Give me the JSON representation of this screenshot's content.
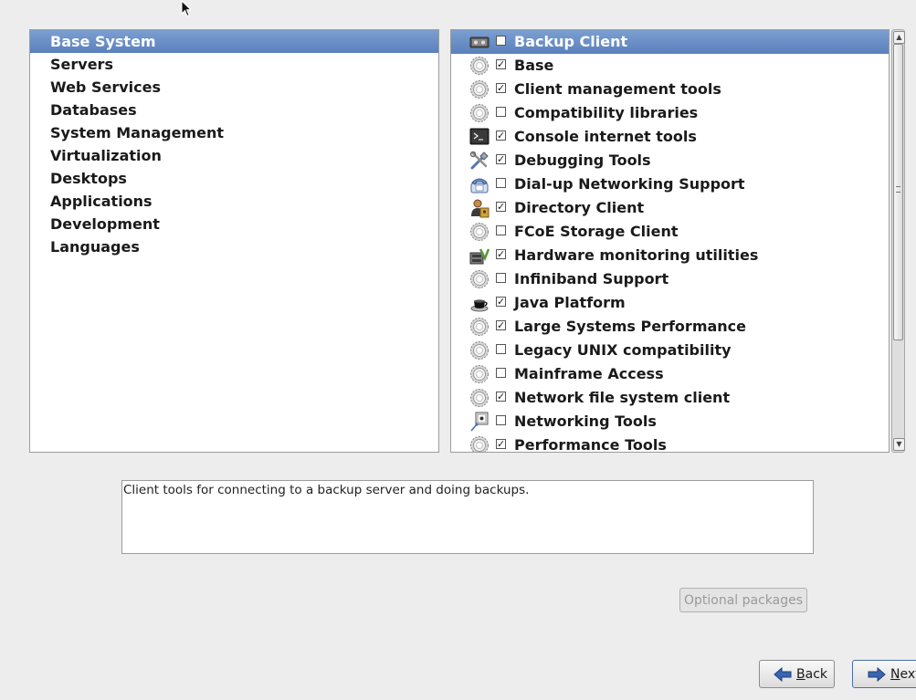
{
  "categories": [
    {
      "label": "Base System",
      "selected": true
    },
    {
      "label": "Servers"
    },
    {
      "label": "Web Services"
    },
    {
      "label": "Databases"
    },
    {
      "label": "System Management"
    },
    {
      "label": "Virtualization"
    },
    {
      "label": "Desktops"
    },
    {
      "label": "Applications"
    },
    {
      "label": "Development"
    },
    {
      "label": "Languages"
    }
  ],
  "groups": [
    {
      "label": "Backup Client",
      "checked": false,
      "icon": "backup-drive-icon",
      "selected": true
    },
    {
      "label": "Base",
      "checked": true,
      "icon": "gear-icon"
    },
    {
      "label": "Client management tools",
      "checked": true,
      "icon": "gear-icon"
    },
    {
      "label": "Compatibility libraries",
      "checked": false,
      "icon": "gear-icon"
    },
    {
      "label": "Console internet tools",
      "checked": true,
      "icon": "terminal-icon"
    },
    {
      "label": "Debugging Tools",
      "checked": true,
      "icon": "tools-icon"
    },
    {
      "label": "Dial-up Networking Support",
      "checked": false,
      "icon": "phone-icon"
    },
    {
      "label": "Directory Client",
      "checked": true,
      "icon": "users-icon"
    },
    {
      "label": "FCoE Storage Client",
      "checked": false,
      "icon": "gear-icon"
    },
    {
      "label": "Hardware monitoring utilities",
      "checked": true,
      "icon": "hardware-monitor-icon"
    },
    {
      "label": "Infiniband Support",
      "checked": false,
      "icon": "gear-icon"
    },
    {
      "label": "Java Platform",
      "checked": true,
      "icon": "java-cup-icon"
    },
    {
      "label": "Large Systems Performance",
      "checked": true,
      "icon": "gear-icon"
    },
    {
      "label": "Legacy UNIX compatibility",
      "checked": false,
      "icon": "gear-icon"
    },
    {
      "label": "Mainframe Access",
      "checked": false,
      "icon": "gear-icon"
    },
    {
      "label": "Network file system client",
      "checked": true,
      "icon": "gear-icon"
    },
    {
      "label": "Networking Tools",
      "checked": false,
      "icon": "network-tools-icon"
    },
    {
      "label": "Performance Tools",
      "checked": true,
      "icon": "gear-icon"
    }
  ],
  "description": "Client tools for connecting to a backup server and doing backups.",
  "buttons": {
    "optional_packages": "Optional packages",
    "back": "Back",
    "next": "Next"
  },
  "colors": {
    "selection": "#5a80bd",
    "background": "#ededed"
  }
}
